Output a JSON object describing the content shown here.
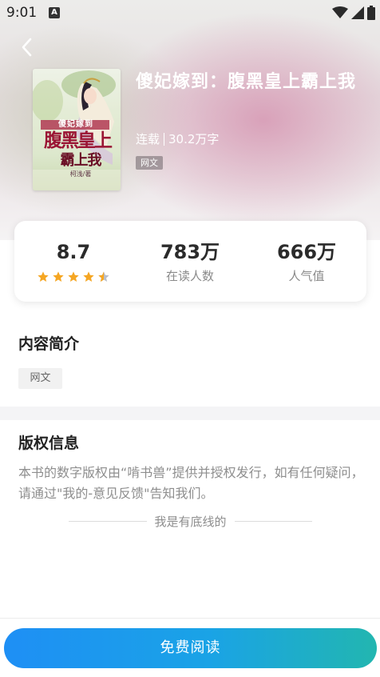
{
  "status_bar": {
    "time": "9:01",
    "notification_icon": "A",
    "icons": [
      "wifi-icon",
      "signal-icon",
      "battery-icon"
    ]
  },
  "book": {
    "title": "傻妃嫁到：腹黑皇上霸上我",
    "status": "连载",
    "word_count": "30.2万字",
    "tag": "网文",
    "cover": {
      "text_top": "傻妃嫁到",
      "text_main_1": "腹黑皇上",
      "text_main_2": "霸上我",
      "author": "柯浅/著"
    }
  },
  "stats": {
    "score": "8.7",
    "rating_stars": 4.5,
    "readers_value": "783万",
    "readers_label": "在读人数",
    "popularity_value": "666万",
    "popularity_label": "人气值"
  },
  "intro": {
    "title": "内容简介",
    "tag": "网文"
  },
  "copyright": {
    "title": "版权信息",
    "text": "本书的数字版权由“啃书兽”提供并授权发行，如有任何疑问，请通过\"我的-意见反馈\"告知我们。"
  },
  "bottom_line_text": "我是有底线的",
  "read_button_label": "免费阅读",
  "colors": {
    "star": "#f5a623",
    "star_empty": "#b8bec9",
    "button_start": "#1e8ff5",
    "button_end": "#22b6b0"
  }
}
